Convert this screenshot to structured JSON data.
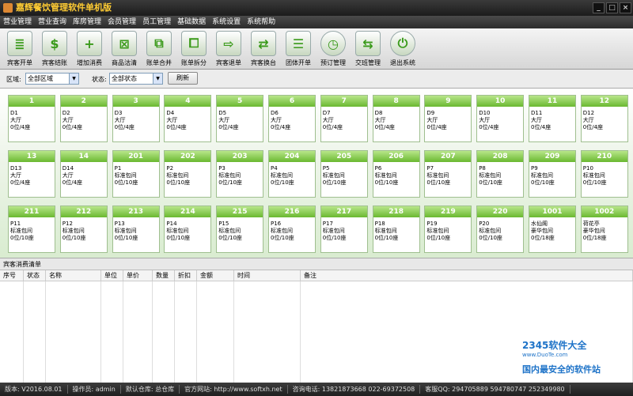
{
  "app": {
    "title": "嘉辉餐饮管理软件单机版",
    "menu": [
      "营业管理",
      "营业查询",
      "库房管理",
      "会员管理",
      "员工管理",
      "基础数据",
      "系统设置",
      "系统帮助"
    ],
    "window_buttons": [
      "_",
      "□",
      "×"
    ]
  },
  "toolbar": [
    {
      "label": "宾客开单",
      "icon": "list-icon",
      "glyph": "≣"
    },
    {
      "label": "宾客结账",
      "icon": "dollar-icon",
      "glyph": "$"
    },
    {
      "label": "增加消费",
      "icon": "plus-icon",
      "glyph": "+"
    },
    {
      "label": "商品沽清",
      "icon": "cancel-doc-icon",
      "glyph": "⊠"
    },
    {
      "label": "账单合并",
      "icon": "merge-icon",
      "glyph": "⧉"
    },
    {
      "label": "账单拆分",
      "icon": "split-icon",
      "glyph": "⧠"
    },
    {
      "label": "宾客退单",
      "icon": "return-icon",
      "glyph": "⇨"
    },
    {
      "label": "宾客换台",
      "icon": "swap-icon",
      "glyph": "⇄"
    },
    {
      "label": "团体开单",
      "icon": "group-icon",
      "glyph": "☰"
    },
    {
      "label": "预订管理",
      "icon": "clock-icon",
      "glyph": "◷"
    },
    {
      "label": "交班管理",
      "icon": "shift-icon",
      "glyph": "⇆"
    },
    {
      "label": "退出系统",
      "icon": "power-icon",
      "glyph": "⏻"
    }
  ],
  "filters": {
    "area_label": "区域:",
    "area_value": "全部区域",
    "status_label": "状态:",
    "status_value": "全部状态",
    "refresh_label": "刷新"
  },
  "tables": [
    {
      "no": "1",
      "code": "D1",
      "type": "大厅",
      "seats": "0位/4座"
    },
    {
      "no": "2",
      "code": "D2",
      "type": "大厅",
      "seats": "0位/4座"
    },
    {
      "no": "3",
      "code": "D3",
      "type": "大厅",
      "seats": "0位/4座"
    },
    {
      "no": "4",
      "code": "D4",
      "type": "大厅",
      "seats": "0位/4座"
    },
    {
      "no": "5",
      "code": "D5",
      "type": "大厅",
      "seats": "0位/4座"
    },
    {
      "no": "6",
      "code": "D6",
      "type": "大厅",
      "seats": "0位/4座"
    },
    {
      "no": "7",
      "code": "D7",
      "type": "大厅",
      "seats": "0位/4座"
    },
    {
      "no": "8",
      "code": "D8",
      "type": "大厅",
      "seats": "0位/4座"
    },
    {
      "no": "9",
      "code": "D9",
      "type": "大厅",
      "seats": "0位/4座"
    },
    {
      "no": "10",
      "code": "D10",
      "type": "大厅",
      "seats": "0位/4座"
    },
    {
      "no": "11",
      "code": "D11",
      "type": "大厅",
      "seats": "0位/4座"
    },
    {
      "no": "12",
      "code": "D12",
      "type": "大厅",
      "seats": "0位/4座"
    },
    {
      "no": "13",
      "code": "D13",
      "type": "大厅",
      "seats": "0位/4座"
    },
    {
      "no": "14",
      "code": "D14",
      "type": "大厅",
      "seats": "0位/4座"
    },
    {
      "no": "201",
      "code": "P1",
      "type": "标准包间",
      "seats": "0位/10座"
    },
    {
      "no": "202",
      "code": "P2",
      "type": "标准包间",
      "seats": "0位/10座"
    },
    {
      "no": "203",
      "code": "P3",
      "type": "标准包间",
      "seats": "0位/10座"
    },
    {
      "no": "204",
      "code": "P4",
      "type": "标准包间",
      "seats": "0位/10座"
    },
    {
      "no": "205",
      "code": "P5",
      "type": "标准包间",
      "seats": "0位/10座"
    },
    {
      "no": "206",
      "code": "P6",
      "type": "标准包间",
      "seats": "0位/10座"
    },
    {
      "no": "207",
      "code": "P7",
      "type": "标准包间",
      "seats": "0位/10座"
    },
    {
      "no": "208",
      "code": "P8",
      "type": "标准包间",
      "seats": "0位/10座"
    },
    {
      "no": "209",
      "code": "P9",
      "type": "标准包间",
      "seats": "0位/10座"
    },
    {
      "no": "210",
      "code": "P10",
      "type": "标准包间",
      "seats": "0位/10座"
    },
    {
      "no": "211",
      "code": "P11",
      "type": "标准包间",
      "seats": "0位/10座"
    },
    {
      "no": "212",
      "code": "P12",
      "type": "标准包间",
      "seats": "0位/10座"
    },
    {
      "no": "213",
      "code": "P13",
      "type": "标准包间",
      "seats": "0位/10座"
    },
    {
      "no": "214",
      "code": "P14",
      "type": "标准包间",
      "seats": "0位/10座"
    },
    {
      "no": "215",
      "code": "P15",
      "type": "标准包间",
      "seats": "0位/10座"
    },
    {
      "no": "216",
      "code": "P16",
      "type": "标准包间",
      "seats": "0位/10座"
    },
    {
      "no": "217",
      "code": "P17",
      "type": "标准包间",
      "seats": "0位/10座"
    },
    {
      "no": "218",
      "code": "P18",
      "type": "标准包间",
      "seats": "0位/10座"
    },
    {
      "no": "219",
      "code": "P19",
      "type": "标准包间",
      "seats": "0位/10座"
    },
    {
      "no": "220",
      "code": "P20",
      "type": "标准包间",
      "seats": "0位/10座"
    },
    {
      "no": "1001",
      "code": "水仙阁",
      "type": "豪华包间",
      "seats": "0位/18座"
    },
    {
      "no": "1002",
      "code": "荷花亭",
      "type": "豪华包间",
      "seats": "0位/18座"
    }
  ],
  "consumption_list": {
    "title": "宾客消费清单",
    "columns": [
      "序号",
      "状态",
      "名称",
      "单位",
      "单价",
      "数量",
      "折扣",
      "金额",
      "时间",
      "备注"
    ]
  },
  "statusbar": [
    "版本: V2016.08.01",
    "操作员: admin",
    "默认仓库: 总仓库",
    "官方网站: http://www.softxh.net",
    "咨询电话: 13821873668 022-69372508",
    "客服QQ: 294705889 594780747 252349980"
  ],
  "watermarks": {
    "center": "www.DuoTe.com",
    "brand": "2345软件大全",
    "brand_url": "www.DuoTe.com",
    "brand_slogan": "国内最安全的软件站"
  },
  "colors": {
    "table_header": "#6ab830",
    "chrome_dark": "#2c2c2c",
    "title_text": "#ffcc33"
  }
}
